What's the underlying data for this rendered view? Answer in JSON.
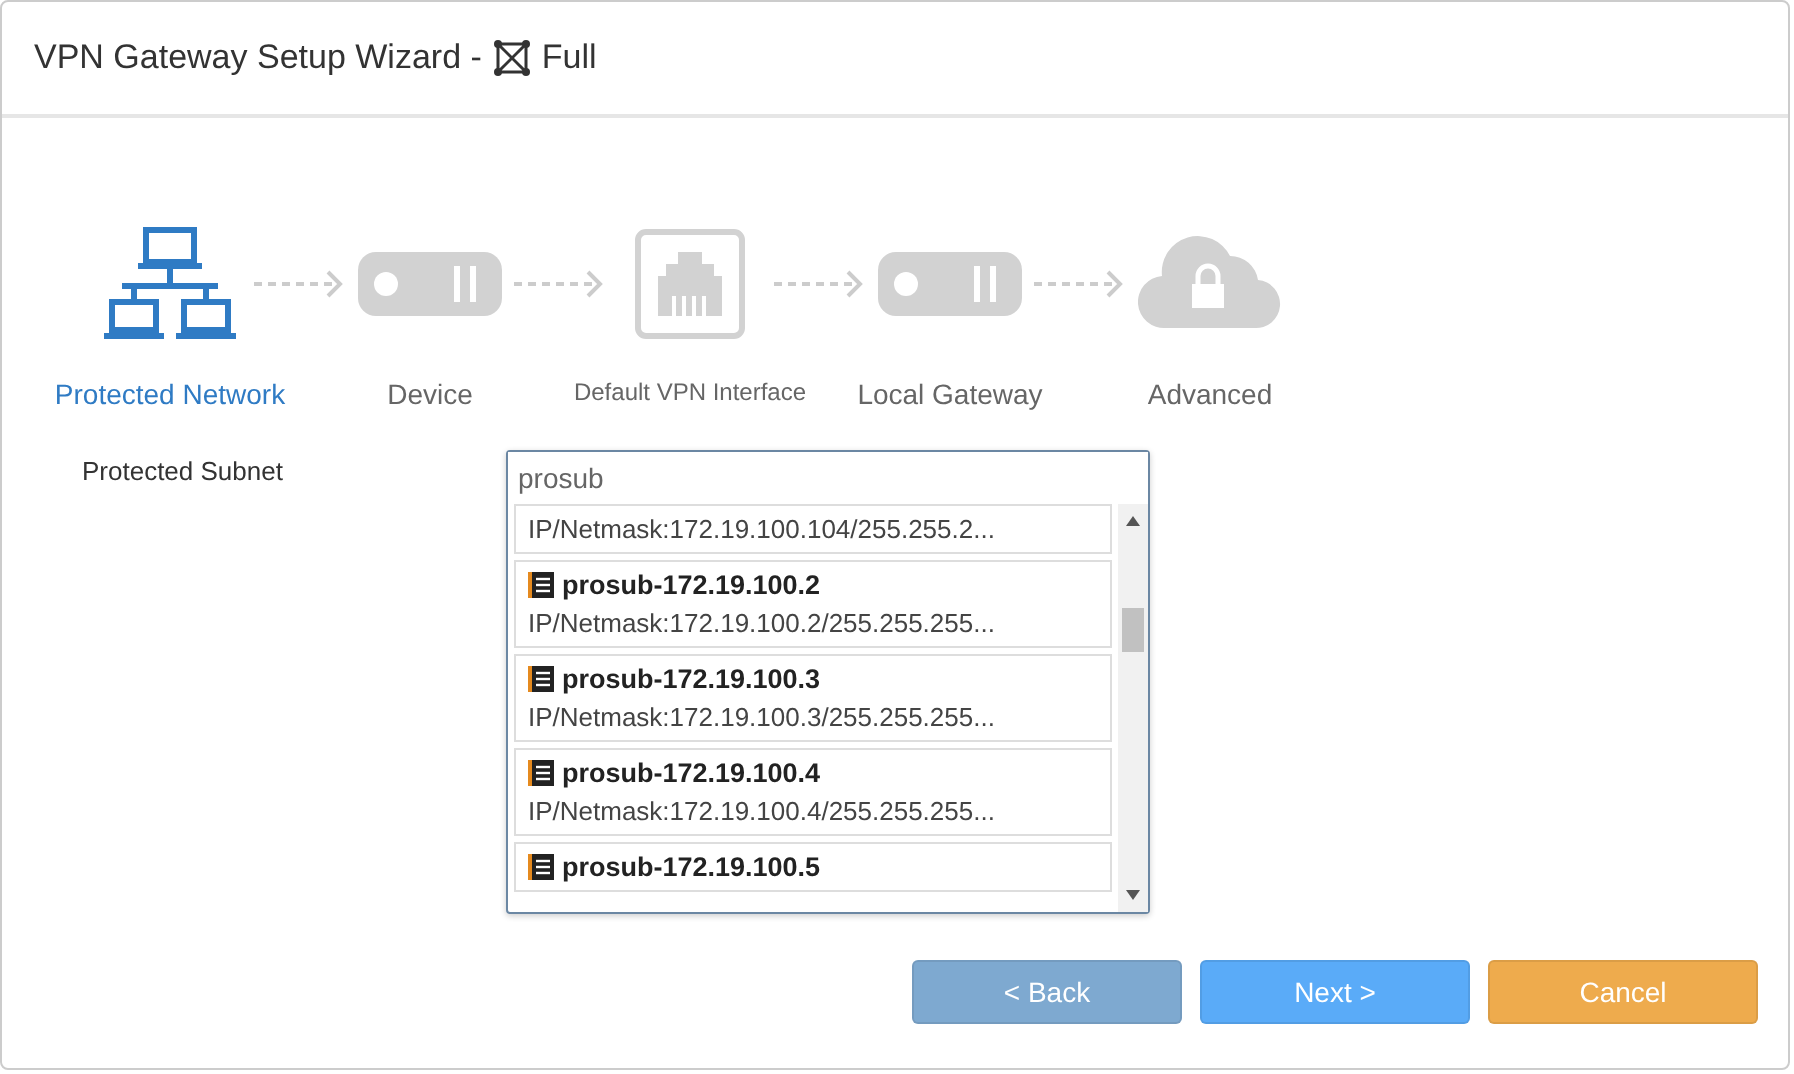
{
  "window": {
    "title": "VPN Gateway Setup Wizard -",
    "mode": "Full"
  },
  "steps": [
    {
      "label": "Protected Network",
      "kind": "network",
      "selected": true
    },
    {
      "label": "Device",
      "kind": "device",
      "selected": false
    },
    {
      "label": "Default VPN Interface",
      "kind": "port",
      "selected": false
    },
    {
      "label": "Local Gateway",
      "kind": "device",
      "selected": false
    },
    {
      "label": "Advanced",
      "kind": "cloud",
      "selected": false
    }
  ],
  "form": {
    "label": "Protected Subnet",
    "search": {
      "value": "prosub"
    },
    "options": [
      {
        "detail": "IP/Netmask:172.19.100.104/255.255.2..."
      },
      {
        "name": "prosub-172.19.100.2",
        "detail": "IP/Netmask:172.19.100.2/255.255.255..."
      },
      {
        "name": "prosub-172.19.100.3",
        "detail": "IP/Netmask:172.19.100.3/255.255.255..."
      },
      {
        "name": "prosub-172.19.100.4",
        "detail": "IP/Netmask:172.19.100.4/255.255.255..."
      },
      {
        "name": "prosub-172.19.100.5"
      }
    ]
  },
  "buttons": [
    {
      "label": "< Back",
      "kind": "back"
    },
    {
      "label": "Next >",
      "kind": "next"
    },
    {
      "label": "Cancel",
      "kind": "cancel"
    }
  ]
}
